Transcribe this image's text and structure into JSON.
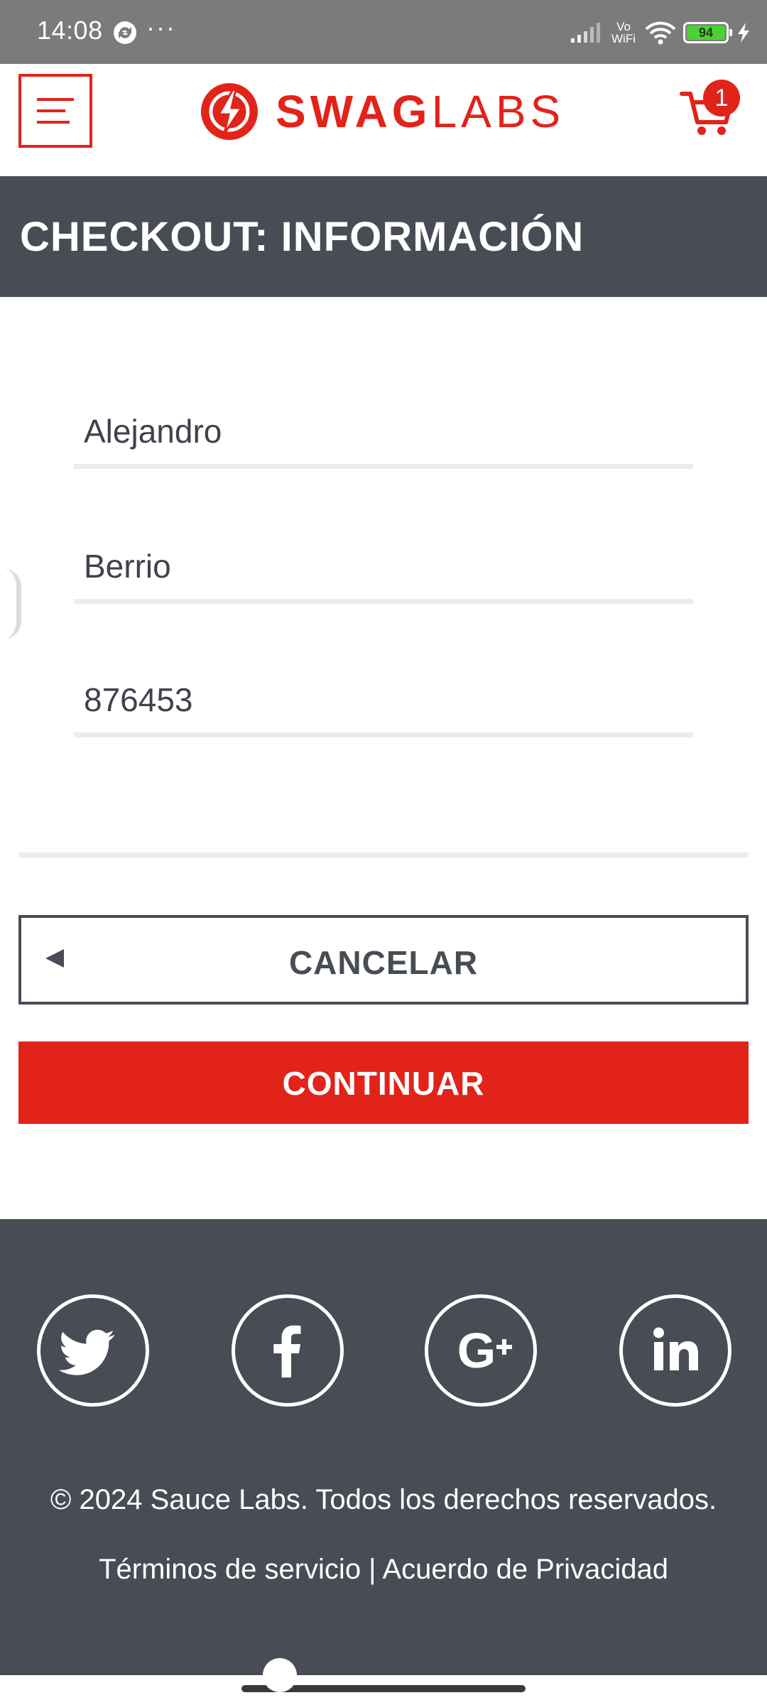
{
  "status_bar": {
    "time": "14:08",
    "more": "···",
    "vowifi": "Vo\nWiFi",
    "battery": "94",
    "icons": [
      "app-sync-icon",
      "signal-icon",
      "wifi-icon",
      "battery-icon",
      "charging-bolt-icon"
    ]
  },
  "header": {
    "logo_swag": "SWAG",
    "logo_labs": "LABS",
    "cart_count": "1",
    "icons": [
      "menu-icon",
      "logo-bolt-icon",
      "cart-icon"
    ]
  },
  "page": {
    "title": "CHECKOUT: INFORMACIÓN"
  },
  "form": {
    "first_name": "Alejandro",
    "last_name": "Berrio",
    "postal_code": "876453"
  },
  "buttons": {
    "cancel": "CANCELAR",
    "continue": "CONTINUAR"
  },
  "footer": {
    "social": [
      "twitter",
      "facebook",
      "google-plus",
      "linkedin"
    ],
    "copyright": "© 2024 Sauce Labs. Todos los derechos reservados.",
    "links": "Términos de servicio | Acuerdo de Privacidad"
  },
  "colors": {
    "brand_red": "#e2231a",
    "dark_slate": "#474c55",
    "status_bar": "#7b7b7b"
  }
}
